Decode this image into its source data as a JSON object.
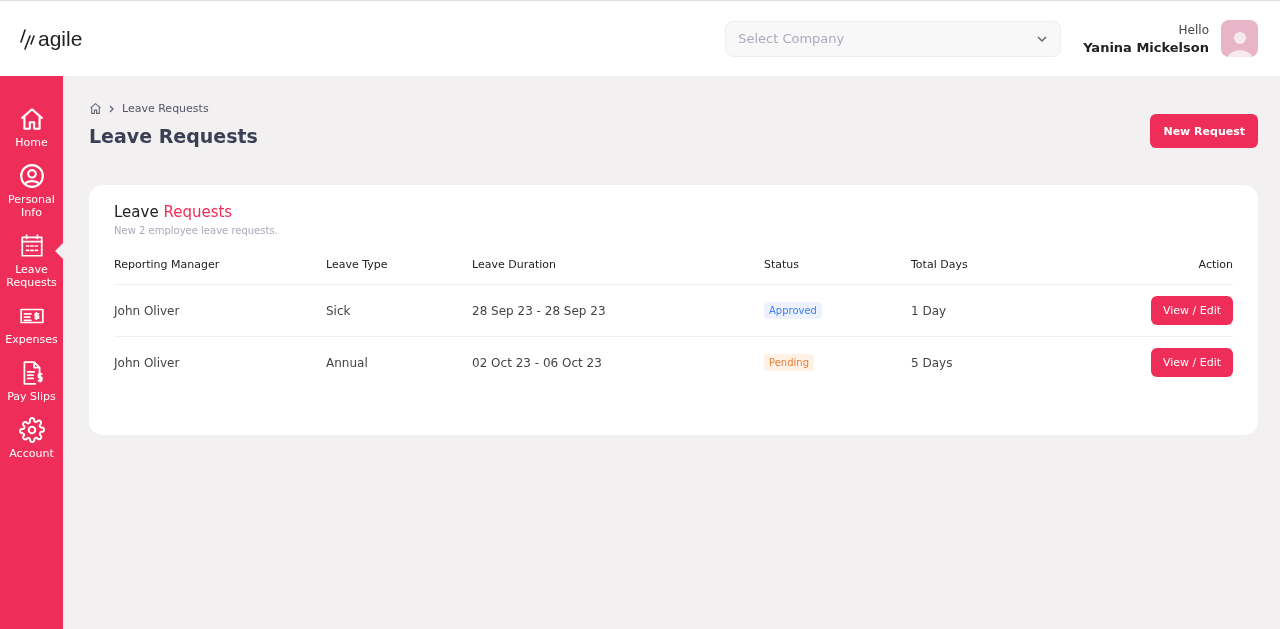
{
  "header": {
    "logo": "agile",
    "company_select": {
      "placeholder": "Select Company"
    },
    "greeting": "Hello",
    "user_name": "Yanina Mickelson"
  },
  "sidebar": {
    "items": [
      {
        "label": "Home",
        "kind": "home",
        "selected": false
      },
      {
        "label": "Personal Info",
        "kind": "profile",
        "selected": false
      },
      {
        "label": "Leave Requests",
        "kind": "leave",
        "selected": true
      },
      {
        "label": "Expenses",
        "kind": "expenses",
        "selected": false
      },
      {
        "label": "Pay Slips",
        "kind": "payslips",
        "selected": false
      },
      {
        "label": "Account",
        "kind": "account",
        "selected": false
      }
    ]
  },
  "breadcrumb": {
    "current": "Leave Requests"
  },
  "page_title": "Leave Requests",
  "new_request_button": "New Request",
  "card": {
    "title": "Leave",
    "title_accent": "Requests",
    "subtitle": "New 2 employee leave requests.",
    "table": {
      "columns": [
        "Reporting Manager",
        "Leave Type",
        "Leave Duration",
        "Status",
        "Total Days",
        "Action"
      ],
      "rows": [
        {
          "manager": "John Oliver",
          "type": "Sick",
          "duration": "28 Sep 23 - 28 Sep 23",
          "status": {
            "label": "Approved",
            "kind": "approved"
          },
          "days": "1 Day",
          "action": "View / Edit"
        },
        {
          "manager": "John Oliver",
          "type": "Annual",
          "duration": "02 Oct 23 - 06 Oct 23",
          "status": {
            "label": "Pending",
            "kind": "pending"
          },
          "days": "5 Days",
          "action": "View / Edit"
        }
      ]
    }
  }
}
